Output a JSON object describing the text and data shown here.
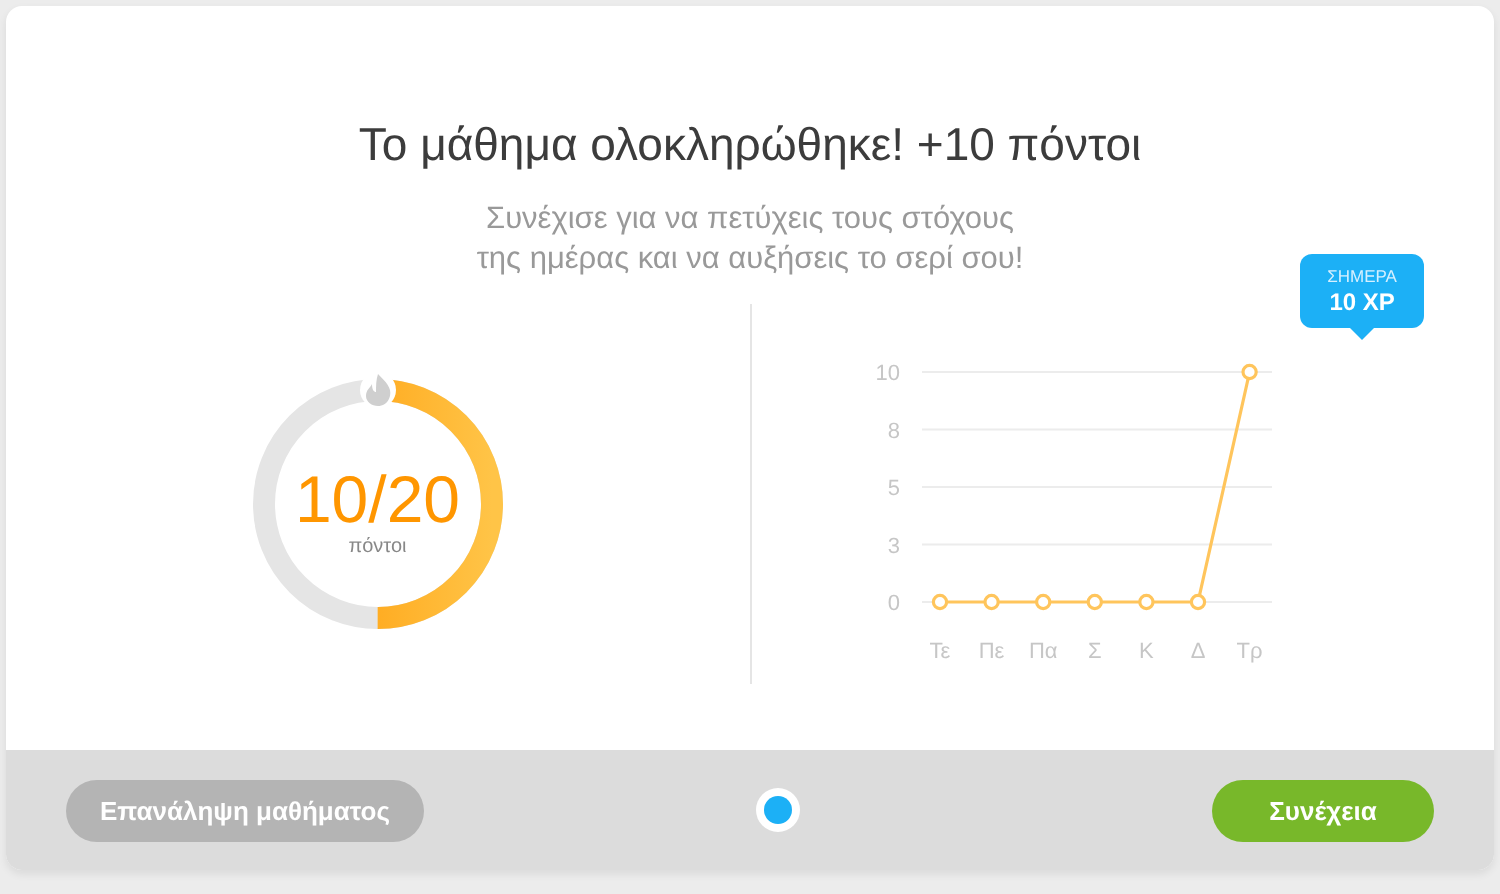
{
  "title": "Το μάθημα ολοκληρώθηκε! +10 πόντοι",
  "subtitle_lines": [
    "Συνέχισε για να πετύχεις τους στόχους",
    "της ημέρας και να αυξήσεις το σερί σου!"
  ],
  "progress": {
    "value": "10/20",
    "unit": "πόντοι"
  },
  "chart": {
    "tooltip": {
      "label": "ΣΗΜΕΡΑ",
      "value": "10 XP"
    },
    "chart_data": {
      "type": "line",
      "categories": [
        "Τε",
        "Πε",
        "Πα",
        "Σ",
        "Κ",
        "Δ",
        "Τρ"
      ],
      "series": [
        {
          "color": "#ffc55c",
          "marker": true,
          "values": [
            0,
            0,
            0,
            0,
            0,
            0,
            10
          ]
        }
      ],
      "grid": true,
      "ylim": [
        0,
        10
      ],
      "yticks": [
        0,
        {
          "value": 2.5,
          "label": "3"
        },
        5,
        {
          "value": 7.5,
          "label": "8"
        },
        10
      ]
    }
  },
  "footer": {
    "buttons": [
      {
        "label": "Επανάληψη μαθήματος",
        "kind": "secondary"
      },
      {
        "label": "Συνέχεια",
        "kind": "primary"
      }
    ]
  }
}
